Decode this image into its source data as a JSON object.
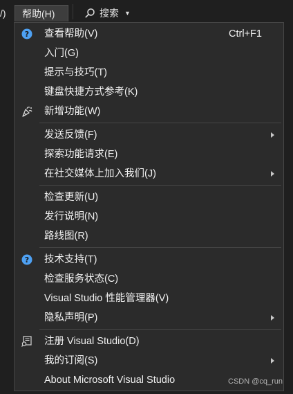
{
  "menubar": {
    "prev_label": "/)",
    "help_label": "帮助(H)",
    "search_label": "搜索",
    "search_icon": "search-icon",
    "caret_icon": "chevron-down-icon"
  },
  "menu": {
    "items": [
      {
        "label": "查看帮助(V)",
        "shortcut": "Ctrl+F1",
        "icon": "help-circle-icon"
      },
      {
        "label": "入门(G)"
      },
      {
        "label": "提示与技巧(T)"
      },
      {
        "label": "键盘快捷方式参考(K)"
      },
      {
        "label": "新增功能(W)",
        "icon": "party-popper-icon"
      },
      {
        "label": "发送反馈(F)",
        "submenu": true
      },
      {
        "label": "探索功能请求(E)"
      },
      {
        "label": "在社交媒体上加入我们(J)",
        "submenu": true
      },
      {
        "label": "检查更新(U)"
      },
      {
        "label": "发行说明(N)"
      },
      {
        "label": "路线图(R)"
      },
      {
        "label": "技术支持(T)",
        "icon": "help-circle-icon"
      },
      {
        "label": "检查服务状态(C)"
      },
      {
        "label": "Visual Studio 性能管理器(V)"
      },
      {
        "label": "隐私声明(P)",
        "submenu": true
      },
      {
        "label": "注册 Visual Studio(D)",
        "icon": "register-key-icon"
      },
      {
        "label": "我的订阅(S)",
        "submenu": true
      },
      {
        "label": "About Microsoft Visual Studio"
      }
    ]
  },
  "watermark": "CSDN @cq_run",
  "colors": {
    "menu_bg": "#2b2b2b",
    "highlight_bg": "#3d3d3d",
    "help_icon_blue": "#4ea1f3",
    "text": "#f1f1f1"
  }
}
